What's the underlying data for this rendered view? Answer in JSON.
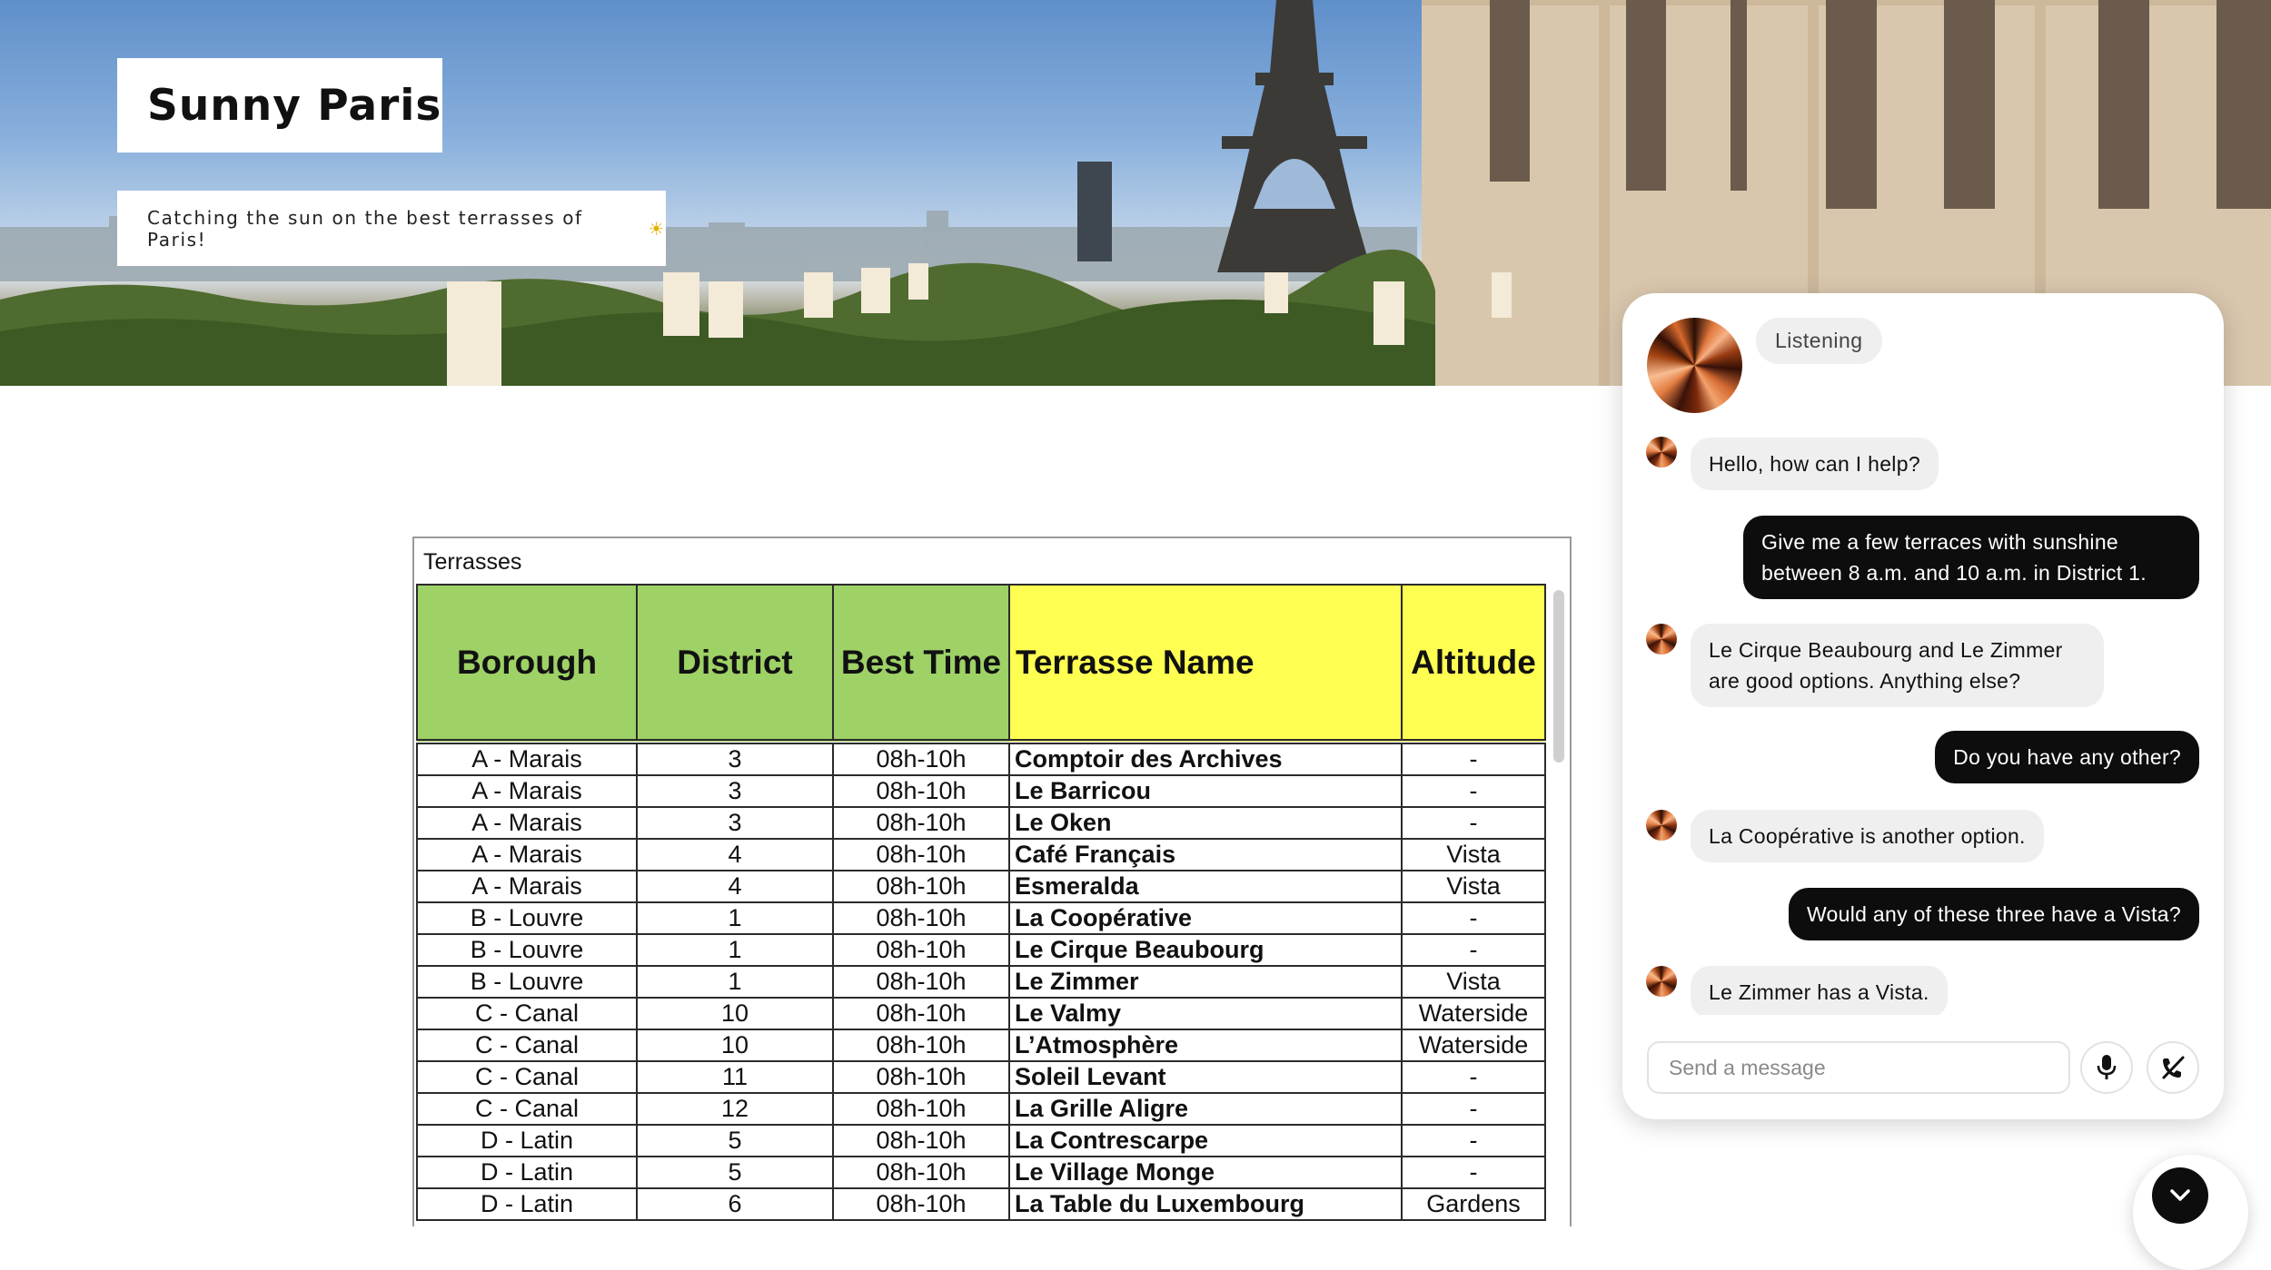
{
  "hero": {
    "title": "Sunny Paris",
    "subtitle": "Catching the sun on the best terrasses of Paris!",
    "subtitle_emoji": "☀"
  },
  "sheet": {
    "tab_name": "Terrasses",
    "header_colors": {
      "green": "#9ed166",
      "yellow": "#ffff52"
    },
    "columns": [
      "Borough",
      "District",
      "Best Time",
      "Terrasse Name",
      "Altitude"
    ],
    "rows": [
      [
        "A - Marais",
        "3",
        "08h-10h",
        "Comptoir des Archives",
        "-"
      ],
      [
        "A - Marais",
        "3",
        "08h-10h",
        "Le Barricou",
        "-"
      ],
      [
        "A - Marais",
        "3",
        "08h-10h",
        "Le Oken",
        "-"
      ],
      [
        "A - Marais",
        "4",
        "08h-10h",
        "Café Français",
        "Vista"
      ],
      [
        "A - Marais",
        "4",
        "08h-10h",
        "Esmeralda",
        "Vista"
      ],
      [
        "B - Louvre",
        "1",
        "08h-10h",
        "La Coopérative",
        "-"
      ],
      [
        "B - Louvre",
        "1",
        "08h-10h",
        "Le Cirque Beaubourg",
        "-"
      ],
      [
        "B - Louvre",
        "1",
        "08h-10h",
        "Le Zimmer",
        "Vista"
      ],
      [
        "C - Canal",
        "10",
        "08h-10h",
        "Le Valmy",
        "Waterside"
      ],
      [
        "C - Canal",
        "10",
        "08h-10h",
        "L’Atmosphère",
        "Waterside"
      ],
      [
        "C - Canal",
        "11",
        "08h-10h",
        "Soleil Levant",
        "-"
      ],
      [
        "C - Canal",
        "12",
        "08h-10h",
        "La Grille Aligre",
        "-"
      ],
      [
        "D - Latin",
        "5",
        "08h-10h",
        "La Contrescarpe",
        "-"
      ],
      [
        "D - Latin",
        "5",
        "08h-10h",
        "Le Village Monge",
        "-"
      ],
      [
        "D - Latin",
        "6",
        "08h-10h",
        "La Table du Luxembourg",
        "Gardens"
      ]
    ]
  },
  "chat": {
    "status": "Listening",
    "messages": [
      {
        "role": "bot",
        "text": "Hello, how can I help?"
      },
      {
        "role": "user",
        "text": "Give me a few terraces with sunshine between 8 a.m. and 10 a.m. in District 1."
      },
      {
        "role": "bot",
        "text": "Le Cirque Beaubourg and Le Zimmer are good options. Anything else?"
      },
      {
        "role": "user",
        "text": "Do you have any other?"
      },
      {
        "role": "bot",
        "text": "La Coopérative is another option."
      },
      {
        "role": "user",
        "text": "Would any of these three have a Vista?"
      },
      {
        "role": "bot",
        "text": "Le Zimmer has a Vista."
      }
    ],
    "input_placeholder": "Send a message",
    "input_value": "",
    "icons": {
      "mic": "microphone-icon",
      "end_call": "phone-off-icon",
      "collapse": "chevron-down-icon"
    }
  }
}
